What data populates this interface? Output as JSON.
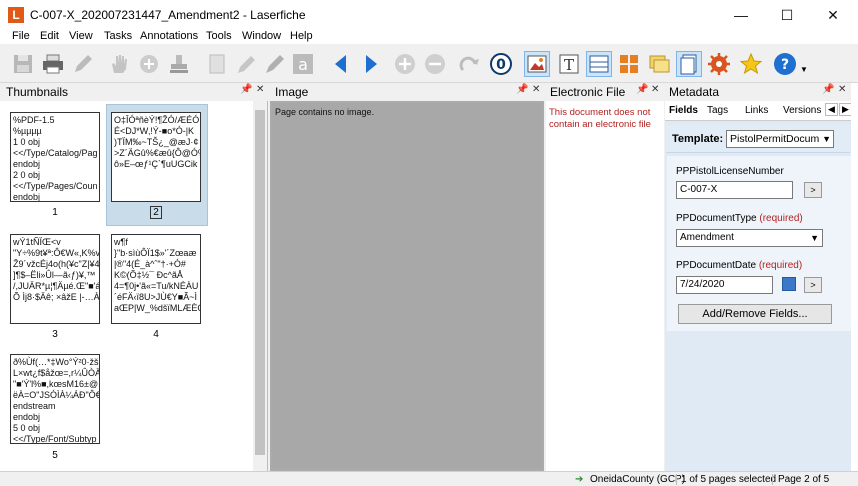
{
  "window": {
    "title": "C-007-X_202007231447_Amendment2 - Laserfiche",
    "app_icon_letter": "L"
  },
  "menu": [
    "File",
    "Edit",
    "View",
    "Tasks",
    "Annotations",
    "Tools",
    "Window",
    "Help"
  ],
  "toolbar": {
    "icons": [
      "save-icon",
      "print-icon",
      "edit-icon",
      "pan-hand-icon",
      "zoom-in-icon",
      "stamp-icon",
      "page-icon",
      "pen-icon",
      "highlighter-icon",
      "text-annotation-icon",
      "previous-page-icon",
      "next-page-icon",
      "zoom-plus-icon",
      "zoom-minus-icon",
      "redo-icon",
      "ocr-icon",
      "image-view-icon",
      "text-view-icon",
      "split-view-icon",
      "thumbnail-grid-icon",
      "sticky-note-icon",
      "document-pages-icon",
      "settings-gear-icon",
      "favorite-star-icon",
      "help-icon"
    ]
  },
  "panes": {
    "thumbnails": "Thumbnails",
    "image": "Image",
    "electronic_file": "Electronic File",
    "metadata": "Metadata"
  },
  "thumbnails": [
    {
      "num": "1",
      "text": "%PDF-1.5\n%µµµµ\n1 0 obj\n<</Type/Catalog/Pag\nendobj\n2 0 obj\n<</Type/Pages/Coun\nendobj"
    },
    {
      "num": "2",
      "text": "O‡ÎÓªñèÝ!¶ŽÓ/ÆÉÓ\nÉ<DJ*W‚!Ý-■o*Ó-|K\n)TÏM‰~TŠ¿_@æJ·¢\n>Z´ÄGû%€æû{Ô@Ó%\nô»E–œƒ¹Ç`¶uUGCik"
    },
    {
      "num": "3",
      "text": "wÝ1tÑÏŒ<v\n\"Y÷%9t¥ª:Ô€W«,K%v\nŽ9´vžcÉj4o(h(¥c\"Z|¥4\n]¶$–Ëli»Ûl—ã‹ƒ)¥,™\n/,JUÄR*µ¦¶Äµé.Œ\"■'á\nÕ Ìj8·$Äê; ×âžE |-…À"
    },
    {
      "num": "4",
      "text": "w¶f\n}\"b·sìùÔÏ1$»'´Zœaæ\n|®\"4(É_à^ˆ\"†·+Ó#\nK©(Õ‡½¯ Ðc^ãÅ\n4=¶0j•'ã«=Tu/kNÉÀU\n´éFÄ‹ï8U>JÙ€Y■Ã~Ì\naŒP|W_%dšïMLÆÈG"
    },
    {
      "num": "5",
      "text": "ð%Ùf(…*‡Wo°Ý²0·žš\nL×wt¿f$åžœ=,r¼ÛÒÄ\n\"■'Ý'l%■,kœsM16±@\nëÀ=O\"JSÓÌÀ¼ÁÐ\"Ô€\nendstream\nendobj\n5 0 obj\n<</Type/Font/Subtyp"
    }
  ],
  "image_pane": {
    "message": "Page contains no image."
  },
  "electronic_file_pane": {
    "message": "This document does not contain an electronic file"
  },
  "metadata": {
    "tabs": [
      "Fields",
      "Tags",
      "Links",
      "Versions"
    ],
    "template_label": "Template:",
    "template_value": "PistolPermitDocum",
    "fields": [
      {
        "label": "PPPistolLicenseNumber",
        "required": "",
        "value": "C-007-X"
      },
      {
        "label": "PPDocumentType",
        "required": "(required)",
        "value": "Amendment"
      },
      {
        "label": "PPDocumentDate",
        "required": "(required)",
        "value": "7/24/2020"
      }
    ],
    "more_button": ">",
    "add_remove_label": "Add/Remove Fields..."
  },
  "statusbar": {
    "repository": "OneidaCounty (GCP)",
    "selection": "1 of 5 pages selected",
    "page": "Page 2 of 5"
  },
  "colors": {
    "accent": "#1e6fd0",
    "required": "#b22222",
    "selection": "#c9dcea"
  }
}
